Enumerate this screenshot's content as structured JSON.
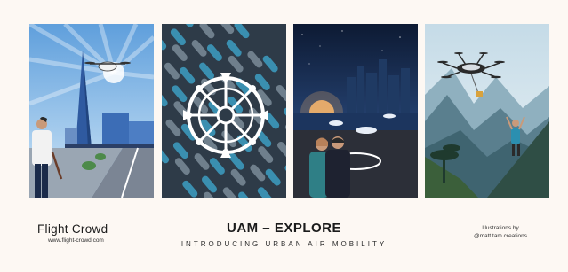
{
  "brand": {
    "name": "Flight Crowd",
    "url": "www.flight-crowd.com"
  },
  "title": "UAM – EXPLORE",
  "subtitle": "INTRODUCING URBAN AIR MOBILITY",
  "credit": {
    "line1": "Illustrations by",
    "line2": "@matt.tam.creations"
  },
  "illustrations": [
    {
      "name": "city-skyline-air-taxi",
      "colors": [
        "#7ab4e8",
        "#2f5aa0",
        "#1e2f4d"
      ]
    },
    {
      "name": "drone-pattern",
      "colors": [
        "#2e3b48",
        "#3a8fb0",
        "#6f7f8c"
      ]
    },
    {
      "name": "night-vertiport",
      "colors": [
        "#0f1e3a",
        "#233d6b",
        "#f4b46b"
      ]
    },
    {
      "name": "mountain-rescue-drone",
      "colors": [
        "#5a7f8e",
        "#2f4e45",
        "#d7e6ee"
      ]
    }
  ]
}
